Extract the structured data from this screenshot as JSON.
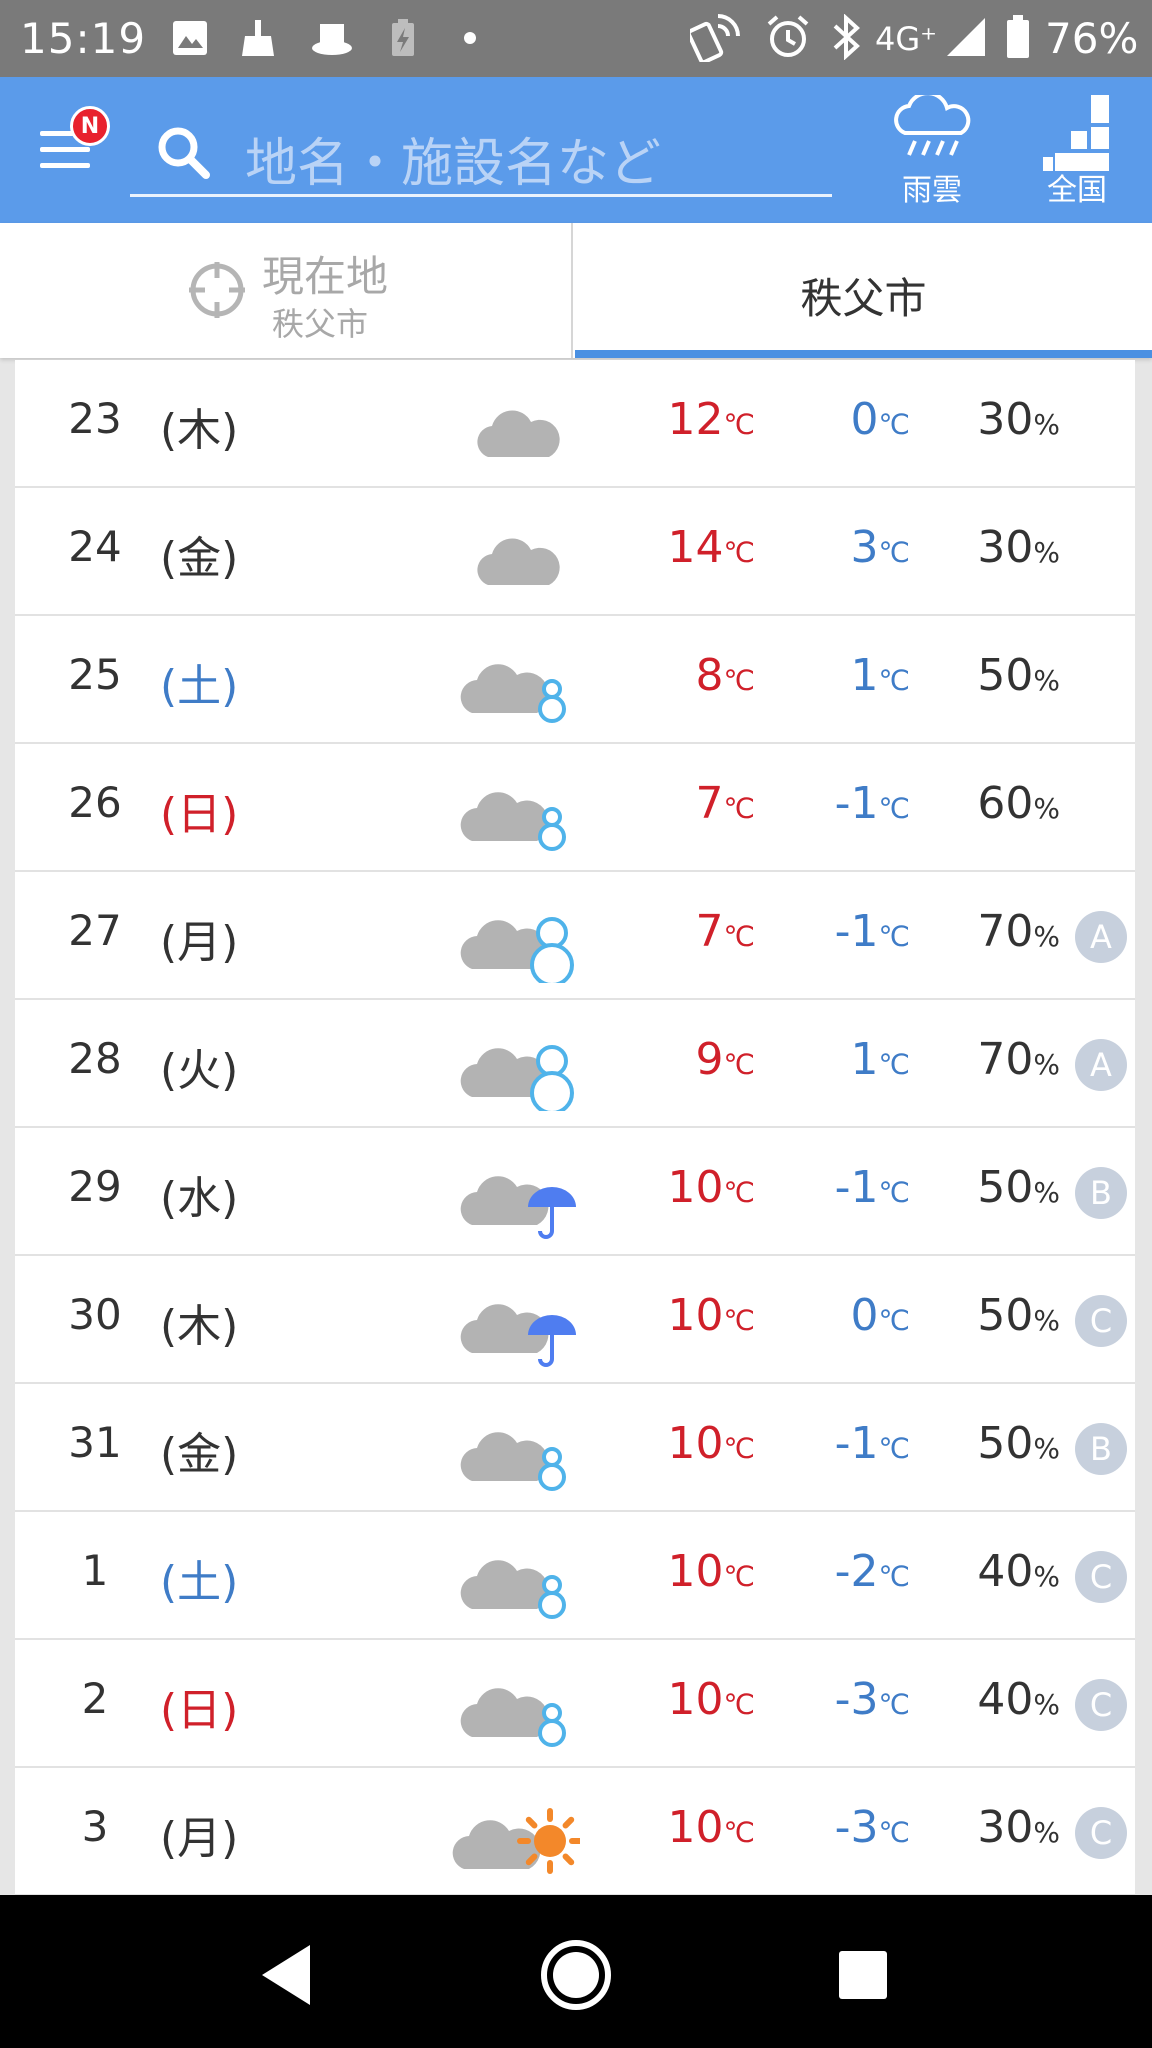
{
  "status_bar": {
    "time": "15:19",
    "network": "4G⁺",
    "battery": "76%"
  },
  "header": {
    "badge": "N",
    "search_placeholder": "地名・施設名など",
    "rain_label": "雨雲",
    "nation_label": "全国"
  },
  "tabs": {
    "current_label": "現在地",
    "current_city": "秩父市",
    "city_label": "秩父市"
  },
  "colors": {
    "header_blue": "#5b9bea",
    "high_temp": "#d0202a",
    "low_temp": "#3f7cc7",
    "saturday": "#3f7cc7",
    "sunday": "#d0202a"
  },
  "units": {
    "temp": "℃",
    "percent": "%"
  },
  "forecast": [
    {
      "date": "23",
      "dow": "(木)",
      "dow_type": "weekday",
      "icon": "cloudy-icon",
      "high": "12",
      "low": "0",
      "pop": "30",
      "rel": ""
    },
    {
      "date": "24",
      "dow": "(金)",
      "dow_type": "weekday",
      "icon": "cloudy-icon",
      "high": "14",
      "low": "3",
      "pop": "30",
      "rel": ""
    },
    {
      "date": "25",
      "dow": "(土)",
      "dow_type": "saturday",
      "icon": "cloudy-snow-small-icon",
      "high": "8",
      "low": "1",
      "pop": "50",
      "rel": ""
    },
    {
      "date": "26",
      "dow": "(日)",
      "dow_type": "sunday",
      "icon": "cloudy-snow-small-icon",
      "high": "7",
      "low": "-1",
      "pop": "60",
      "rel": ""
    },
    {
      "date": "27",
      "dow": "(月)",
      "dow_type": "weekday",
      "icon": "cloudy-snow-large-icon",
      "high": "7",
      "low": "-1",
      "pop": "70",
      "rel": "A"
    },
    {
      "date": "28",
      "dow": "(火)",
      "dow_type": "weekday",
      "icon": "cloudy-snow-large-icon",
      "high": "9",
      "low": "1",
      "pop": "70",
      "rel": "A"
    },
    {
      "date": "29",
      "dow": "(水)",
      "dow_type": "weekday",
      "icon": "cloudy-rain-icon",
      "high": "10",
      "low": "-1",
      "pop": "50",
      "rel": "B"
    },
    {
      "date": "30",
      "dow": "(木)",
      "dow_type": "weekday",
      "icon": "cloudy-rain-icon",
      "high": "10",
      "low": "0",
      "pop": "50",
      "rel": "C"
    },
    {
      "date": "31",
      "dow": "(金)",
      "dow_type": "weekday",
      "icon": "cloudy-snow-small-icon",
      "high": "10",
      "low": "-1",
      "pop": "50",
      "rel": "B"
    },
    {
      "date": "1",
      "dow": "(土)",
      "dow_type": "saturday",
      "icon": "cloudy-snow-small-icon",
      "high": "10",
      "low": "-2",
      "pop": "40",
      "rel": "C"
    },
    {
      "date": "2",
      "dow": "(日)",
      "dow_type": "sunday",
      "icon": "cloudy-snow-small-icon",
      "high": "10",
      "low": "-3",
      "pop": "40",
      "rel": "C"
    },
    {
      "date": "3",
      "dow": "(月)",
      "dow_type": "weekday",
      "icon": "cloudy-sun-icon",
      "high": "10",
      "low": "-3",
      "pop": "30",
      "rel": "C"
    }
  ]
}
